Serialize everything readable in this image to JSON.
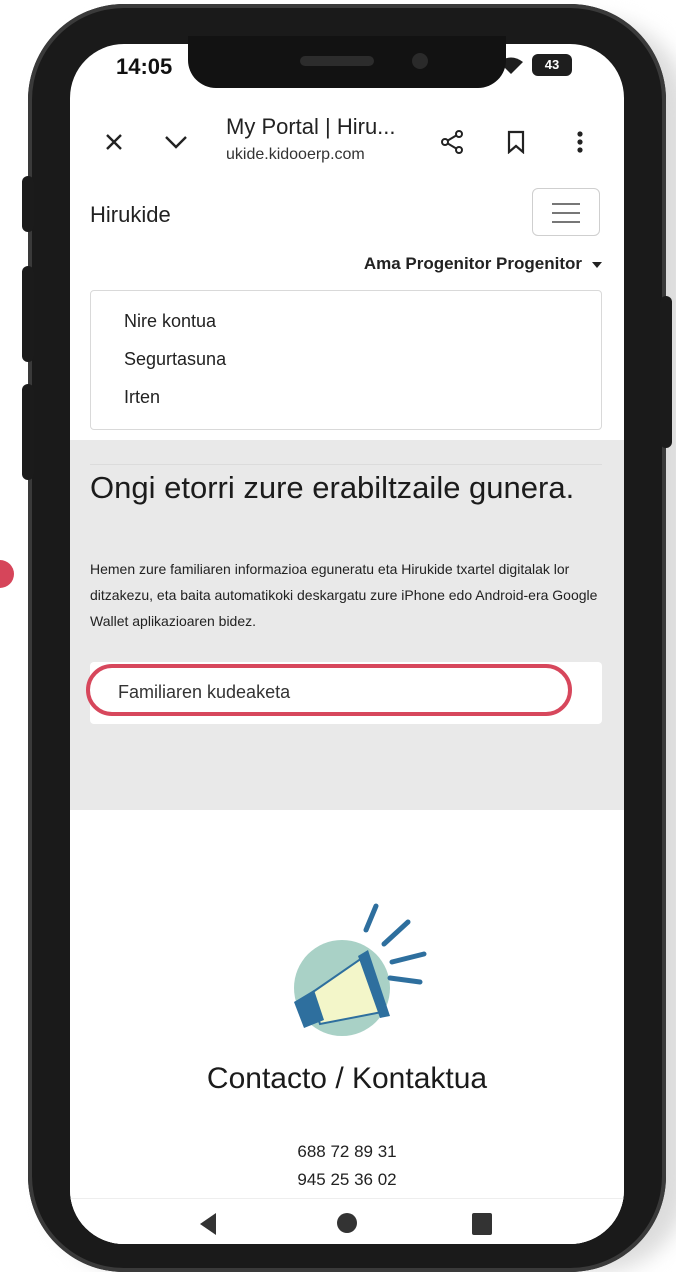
{
  "status_bar": {
    "time": "14:05",
    "battery": "43"
  },
  "browser": {
    "title": "My Portal | Hiru...",
    "url": "ukide.kidooerp.com"
  },
  "header": {
    "brand": "Hirukide",
    "user": "Ama Progenitor Progenitor",
    "menu_items": [
      "Nire kontua",
      "Segurtasuna",
      "Irten"
    ]
  },
  "hero": {
    "title": "Ongi etorri zure erabiltzaile gunera.",
    "text": "Hemen zure familiaren informazioa eguneratu eta Hirukide txartel digitalak lor ditzakezu, eta baita automatikoki deskargatu zure iPhone edo Android-era Google Wallet aplikazioaren bidez.",
    "family_card": "Familiaren kudeaketa"
  },
  "contact": {
    "title": "Contacto / Kontaktua",
    "phones": [
      "688 72 89 31",
      "945 25 36 02"
    ]
  },
  "colors": {
    "highlight": "#d7475c",
    "megaphone_blue": "#2e6f9e",
    "megaphone_bg": "#a9d1c6"
  }
}
